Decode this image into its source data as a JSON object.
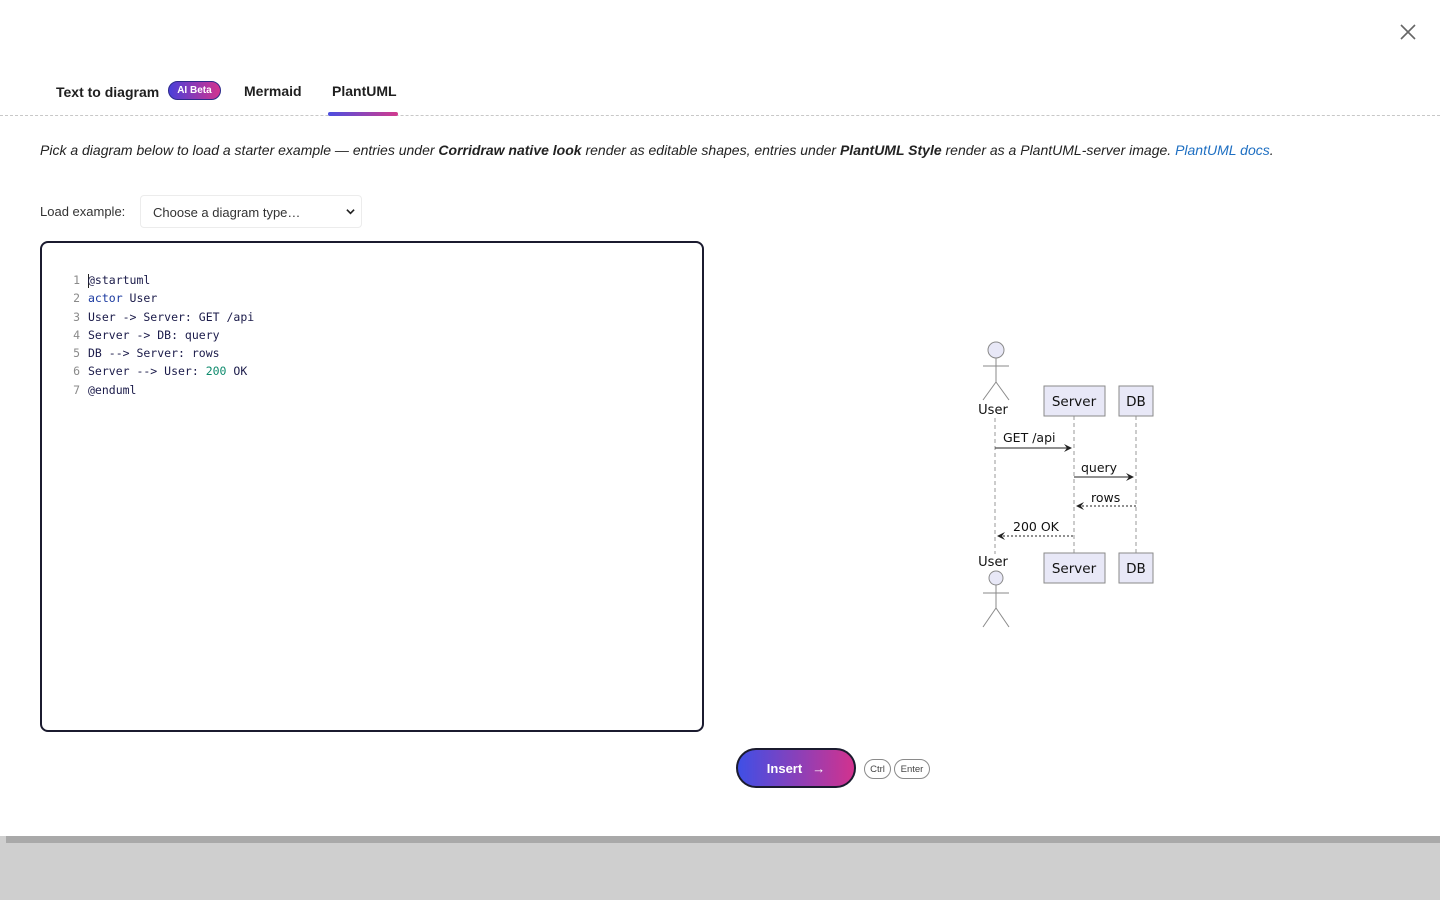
{
  "tabs": [
    {
      "label": "Text to diagram",
      "badge": "AI Beta"
    },
    {
      "label": "Mermaid"
    },
    {
      "label": "PlantUML",
      "active": true
    }
  ],
  "info": {
    "part1": "Pick a diagram below to load a starter example — entries under ",
    "bold1": "Corridraw native look",
    "part2": " render as editable shapes, entries under ",
    "bold2": "PlantUML Style",
    "part3": " render as a PlantUML-server image. ",
    "link": "PlantUML docs",
    "part4": "."
  },
  "load_example": {
    "label": "Load example:",
    "selected": "Choose a diagram type…"
  },
  "editor": {
    "lines": [
      {
        "n": "1",
        "parts": [
          {
            "t": "@startuml",
            "c": "tx"
          }
        ]
      },
      {
        "n": "2",
        "parts": [
          {
            "t": "actor ",
            "c": "kw"
          },
          {
            "t": "User",
            "c": "tx"
          }
        ]
      },
      {
        "n": "3",
        "parts": [
          {
            "t": "User -> Server: GET /api",
            "c": "tx"
          }
        ]
      },
      {
        "n": "4",
        "parts": [
          {
            "t": "Server -> DB: query",
            "c": "tx"
          }
        ]
      },
      {
        "n": "5",
        "parts": [
          {
            "t": "DB --> Server: rows",
            "c": "tx"
          }
        ]
      },
      {
        "n": "6",
        "parts": [
          {
            "t": "Server --> User: ",
            "c": "tx"
          },
          {
            "t": "200",
            "c": "num"
          },
          {
            "t": " OK",
            "c": "tx"
          }
        ]
      },
      {
        "n": "7",
        "parts": [
          {
            "t": "@enduml",
            "c": "tx"
          }
        ]
      }
    ]
  },
  "diagram": {
    "participants": {
      "user": "User",
      "server": "Server",
      "db": "DB"
    },
    "messages": {
      "m1": "GET /api",
      "m2": "query",
      "m3": "rows",
      "m4": "200 OK"
    },
    "colors": {
      "box_fill": "#e8e8f7",
      "box_stroke": "#8a8a8a",
      "lifeline": "#9a9a9a"
    }
  },
  "actions": {
    "insert_label": "Insert",
    "insert_arrow": "→",
    "shortcut_ctrl": "Ctrl",
    "shortcut_enter": "Enter"
  },
  "colors": {
    "accent_start": "#3f4fe6",
    "accent_end": "#d2328e",
    "link": "#1e6fc2"
  }
}
